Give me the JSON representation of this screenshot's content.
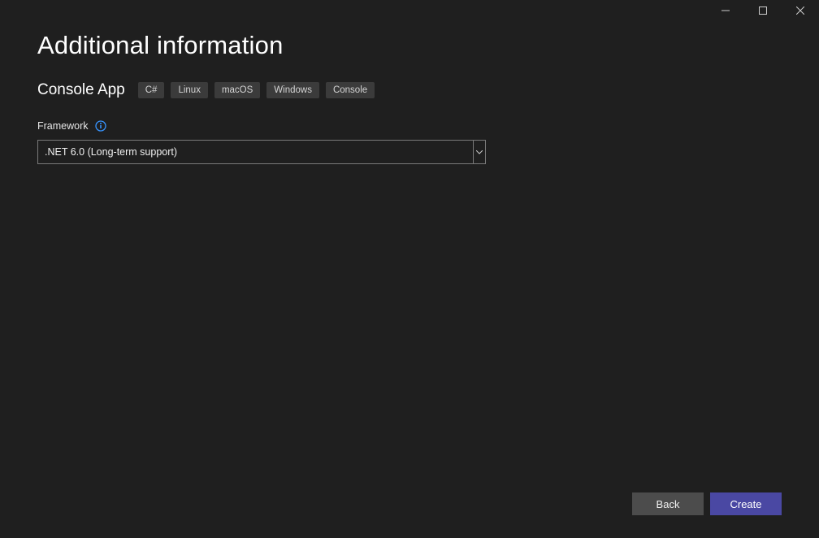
{
  "page": {
    "title": "Additional information"
  },
  "template": {
    "name": "Console App",
    "tags": [
      "C#",
      "Linux",
      "macOS",
      "Windows",
      "Console"
    ]
  },
  "framework": {
    "label": "Framework",
    "selected": ".NET 6.0 (Long-term support)"
  },
  "footer": {
    "back": "Back",
    "create": "Create"
  }
}
